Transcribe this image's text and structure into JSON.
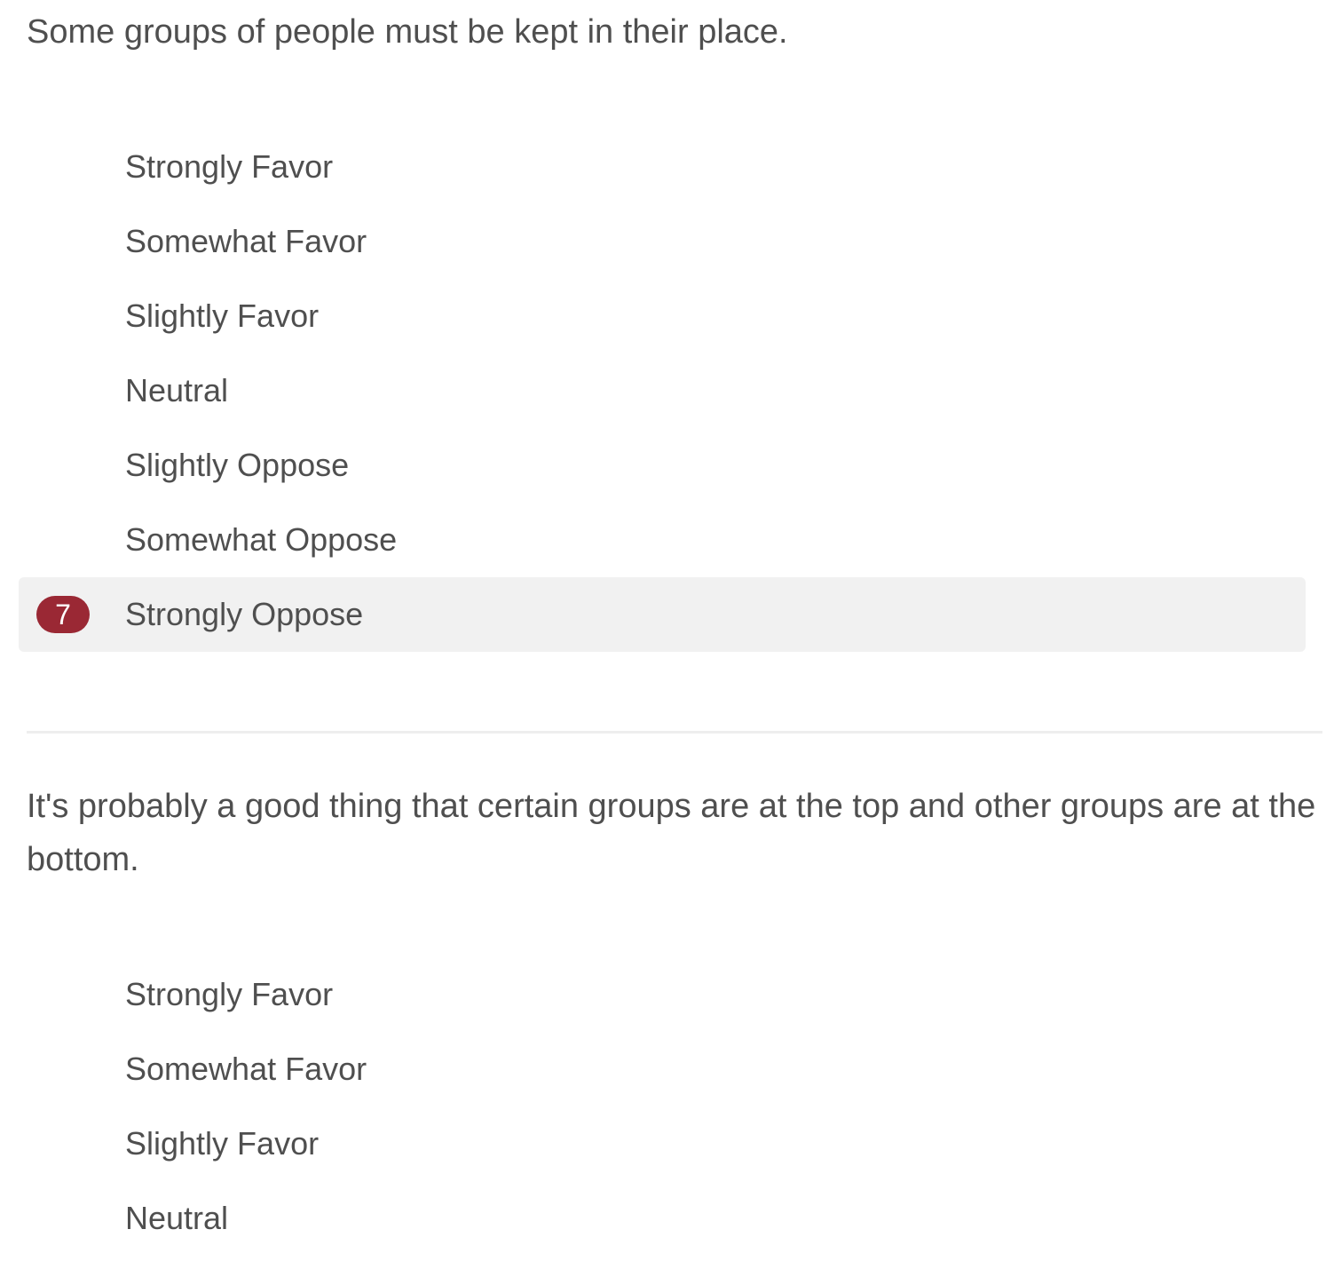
{
  "colors": {
    "selected_badge": "#9a2834",
    "selected_row_bg": "#f1f1f1",
    "text": "#4f4f4f"
  },
  "questions": [
    {
      "text": "Some groups of people must be kept in their place.",
      "options": [
        "Strongly Favor",
        "Somewhat Favor",
        "Slightly Favor",
        "Neutral",
        "Slightly Oppose",
        "Somewhat Oppose",
        "Strongly Oppose"
      ],
      "selected_badge": "7"
    },
    {
      "text": "It's probably a good thing that certain groups are at the top and other groups are at the bottom.",
      "options": [
        "Strongly Favor",
        "Somewhat Favor",
        "Slightly Favor",
        "Neutral"
      ]
    }
  ]
}
